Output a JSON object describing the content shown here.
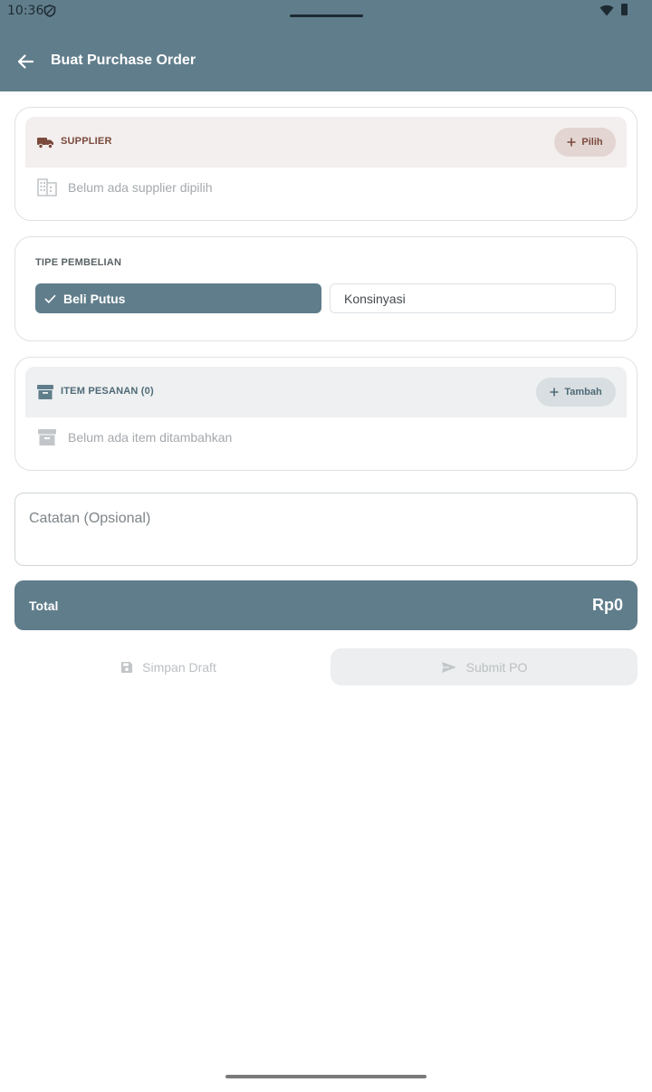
{
  "status_bar": {
    "time": "10:36"
  },
  "app_bar": {
    "title": "Buat Purchase Order"
  },
  "supplier": {
    "header": "SUPPLIER",
    "pick_button": "Pilih",
    "empty_text": "Belum ada supplier dipilih"
  },
  "purchase_type": {
    "label": "TIPE PEMBELIAN",
    "options": [
      "Beli Putus",
      "Konsinyasi"
    ],
    "selected": "Beli Putus"
  },
  "items": {
    "header": "ITEM PESANAN (0)",
    "add_button": "Tambah",
    "empty_text": "Belum ada item ditambahkan"
  },
  "notes": {
    "placeholder": "Catatan (Opsional)"
  },
  "total": {
    "label": "Total",
    "value": "Rp0"
  },
  "actions": {
    "draft_label": "Simpan Draft",
    "submit_label": "Submit PO"
  },
  "colors": {
    "primary": "#607d8b",
    "supplier_accent": "#7a4a3c",
    "supplier_header_bg": "#f3efee",
    "items_header_bg": "#eef0f1"
  }
}
